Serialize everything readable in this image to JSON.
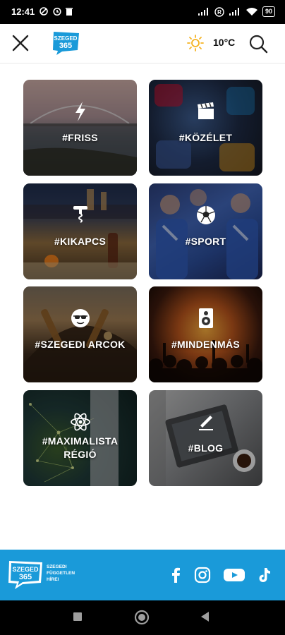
{
  "status": {
    "time": "12:41",
    "battery": "90"
  },
  "header": {
    "logo_text": "SZEGED 365",
    "temperature": "10°C",
    "icons": [
      "close-icon",
      "sun-icon",
      "search-icon"
    ]
  },
  "categories": [
    {
      "label": "#FRISS",
      "icon": "lightning-icon"
    },
    {
      "label": "#KÖZÉLET",
      "icon": "clapperboard-icon"
    },
    {
      "label": "#KIKAPCS",
      "icon": "corkscrew-icon"
    },
    {
      "label": "#SPORT",
      "icon": "soccer-ball-icon"
    },
    {
      "label": "#SZEGEDI ARCOK",
      "icon": "sunglasses-face-icon"
    },
    {
      "label": "#MINDENMÁS",
      "icon": "speaker-icon"
    },
    {
      "label": "#MAXIMALISTA",
      "label2": "RÉGIÓ",
      "icon": "atom-icon"
    },
    {
      "label": "#BLOG",
      "icon": "pen-paper-icon"
    }
  ],
  "footer": {
    "logo_text": "SZEGED 365",
    "tagline_1": "SZEGEDI",
    "tagline_2": "FÜGGETLEN",
    "tagline_3": "HÍREI",
    "social": [
      "facebook-icon",
      "instagram-icon",
      "youtube-icon",
      "tiktok-icon"
    ],
    "background": "#1a9ad9"
  },
  "colors": {
    "accent_blue": "#1a9ad9",
    "sun_yellow": "#f5b323"
  }
}
